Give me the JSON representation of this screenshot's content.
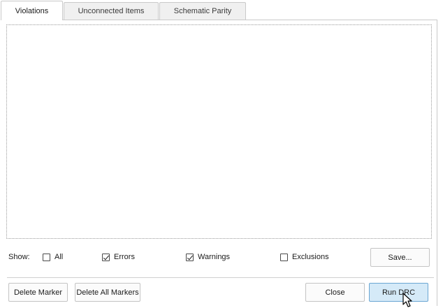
{
  "tabs": [
    {
      "label": "Violations",
      "active": true
    },
    {
      "label": "Unconnected Items",
      "active": false
    },
    {
      "label": "Schematic Parity",
      "active": false
    }
  ],
  "filters": {
    "show_label": "Show:",
    "items": [
      {
        "label": "All",
        "checked": false
      },
      {
        "label": "Errors",
        "checked": true
      },
      {
        "label": "Warnings",
        "checked": true
      },
      {
        "label": "Exclusions",
        "checked": false
      }
    ],
    "save_label": "Save..."
  },
  "footer": {
    "delete_marker_label": "Delete Marker",
    "delete_all_markers_label": "Delete All Markers",
    "close_label": "Close",
    "run_drc_label": "Run DRC"
  },
  "colors": {
    "primary_button_bg": "#d5eaf8",
    "primary_button_border": "#6aa6d2"
  },
  "icons": {
    "cursor": "mouse-pointer-icon"
  }
}
